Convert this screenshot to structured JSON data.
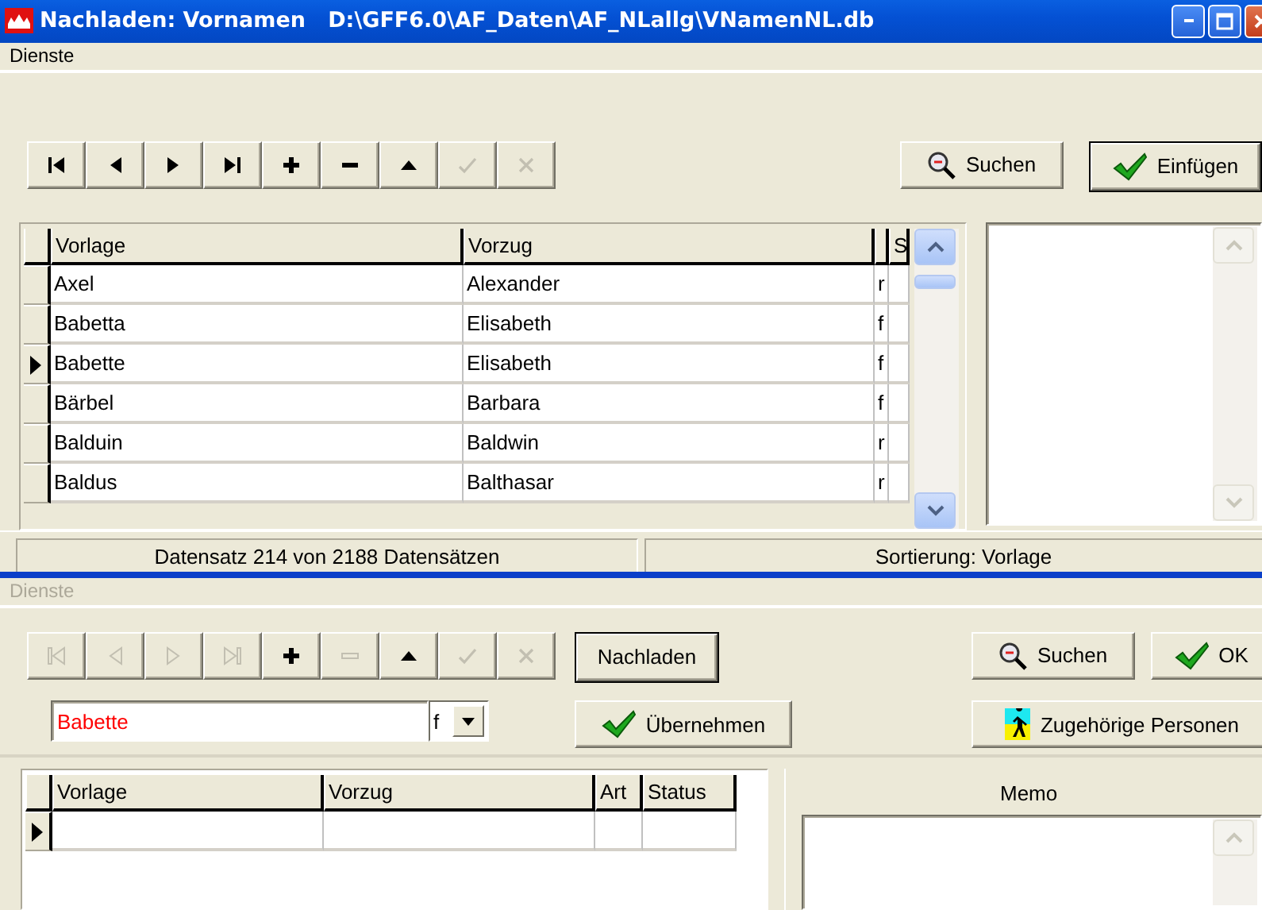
{
  "window": {
    "title": "Nachladen: Vornamen   D:\\GFF6.0\\AF_Daten\\AF_NLallg\\VNamenNL.db"
  },
  "top": {
    "menu": [
      {
        "label": "Dienste",
        "disabled": false
      }
    ],
    "nav": [
      {
        "kind": "first",
        "disabled": false
      },
      {
        "kind": "prev",
        "disabled": false
      },
      {
        "kind": "next",
        "disabled": false
      },
      {
        "kind": "last",
        "disabled": false
      },
      {
        "kind": "add",
        "disabled": false
      },
      {
        "kind": "remove",
        "disabled": false
      },
      {
        "kind": "up",
        "disabled": false
      },
      {
        "kind": "confirm",
        "disabled": true
      },
      {
        "kind": "cancel",
        "disabled": true
      }
    ],
    "buttons": [
      {
        "kind": "search",
        "label": "Suchen",
        "default": false
      },
      {
        "kind": "check",
        "label": "Einfügen",
        "default": true
      }
    ],
    "table": {
      "columns": [
        {
          "label": "Vorlage"
        },
        {
          "label": "Vorzug"
        },
        {},
        {
          "label": "S"
        }
      ],
      "rows": [
        {
          "selected": false,
          "cells": [
            "Axel",
            "Alexander",
            "r"
          ]
        },
        {
          "selected": false,
          "cells": [
            "Babetta",
            "Elisabeth",
            "f"
          ]
        },
        {
          "selected": true,
          "cells": [
            "Babette",
            "Elisabeth",
            "f"
          ]
        },
        {
          "selected": false,
          "cells": [
            "Bärbel",
            "Barbara",
            "f"
          ]
        },
        {
          "selected": false,
          "cells": [
            "Balduin",
            "Baldwin",
            "r"
          ]
        },
        {
          "selected": false,
          "cells": [
            "Baldus",
            "Balthasar",
            "r"
          ]
        }
      ]
    },
    "status_bar": [
      "Datensatz 214 von 2188 Datensätzen",
      "Sortierung: Vorlage"
    ]
  },
  "bottom": {
    "menu": [
      {
        "label": "Dienste",
        "disabled": true
      }
    ],
    "nav": [
      {
        "kind": "first",
        "disabled": true
      },
      {
        "kind": "prev",
        "disabled": true
      },
      {
        "kind": "next",
        "disabled": true
      },
      {
        "kind": "last",
        "disabled": true
      },
      {
        "kind": "add",
        "disabled": false
      },
      {
        "kind": "remove",
        "disabled": true
      },
      {
        "kind": "up",
        "disabled": false
      },
      {
        "kind": "confirm",
        "disabled": true
      },
      {
        "kind": "cancel",
        "disabled": true
      }
    ],
    "reload_button": {
      "label": "Nachladen",
      "default": true
    },
    "buttons": [
      {
        "kind": "search",
        "label": "Suchen",
        "default": false
      },
      {
        "kind": "check",
        "label": "OK",
        "default": false
      }
    ],
    "name_field": {
      "value": "Babette"
    },
    "gender_combo": {
      "value": "f"
    },
    "apply_button": {
      "kind": "check",
      "label": "Übernehmen"
    },
    "persons_button": {
      "kind": "person",
      "label": "Zugehörige Personen"
    },
    "table": {
      "columns": [
        {
          "label": "Vorlage"
        },
        {
          "label": "Vorzug"
        },
        {
          "label": "Art"
        },
        {
          "label": "Status"
        }
      ],
      "rows": [
        {
          "selected": true
        }
      ]
    },
    "memo": {
      "label": "Memo"
    }
  }
}
